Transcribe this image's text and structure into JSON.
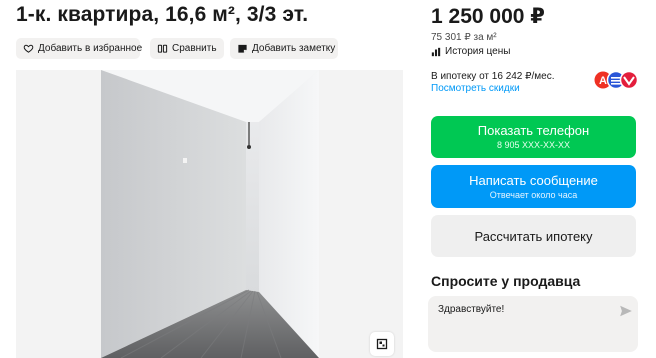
{
  "listing": {
    "title": "1-к. квартира, 16,6 м², 3/3 эт."
  },
  "actions": {
    "favorite_label": "Добавить в избранное",
    "compare_label": "Сравнить",
    "note_label": "Добавить заметку"
  },
  "price": {
    "amount": "1 250 000 ₽",
    "per_meter": "75 301 ₽ за м²",
    "history_label": "История цены"
  },
  "mortgage": {
    "text": "В ипотеку от 16 242 ₽/мес.",
    "discounts_link": "Посмотреть скидки",
    "bank_icons": [
      "alfa-bank-icon",
      "bank-icon",
      "bank-icon"
    ]
  },
  "contact": {
    "phone_label": "Показать телефон",
    "phone_masked": "8 905 XXX-XX-XX",
    "message_label": "Написать сообщение",
    "message_sub": "Отвечает около часа",
    "calc_label": "Рассчитать ипотеку"
  },
  "ask": {
    "title": "Спросите у продавца",
    "input_value": "Здравствуйте!"
  },
  "colors": {
    "phone_button": "#00c853",
    "message_button": "#0099f7",
    "link": "#0099f7",
    "secondary_button": "#efefef"
  }
}
